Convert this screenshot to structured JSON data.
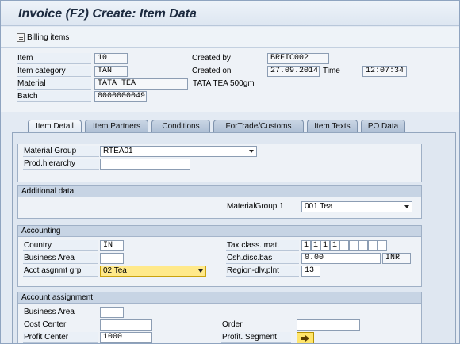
{
  "window": {
    "title": "Invoice  (F2) Create: Item Data"
  },
  "toolbar": {
    "billing_items_label": "Billing items",
    "billing_icon": "document-list-icon"
  },
  "header": {
    "item_label": "Item",
    "item_value": "10",
    "item_category_label": "Item category",
    "item_category_value": "TAN",
    "material_label": "Material",
    "material_value": "TATA TEA",
    "material_desc": "TATA TEA 500gm",
    "batch_label": "Batch",
    "batch_value": "0000000049",
    "created_by_label": "Created by",
    "created_by_value": "BRFIC002",
    "created_on_label": "Created on",
    "created_on_value": "27.09.2014",
    "time_label": "Time",
    "time_value": "12:07:34"
  },
  "tabs": [
    {
      "label": "Item Detail",
      "active": true
    },
    {
      "label": "Item Partners",
      "active": false
    },
    {
      "label": "Conditions",
      "active": false
    },
    {
      "label": "ForTrade/Customs",
      "active": false
    },
    {
      "label": "Item Texts",
      "active": false
    },
    {
      "label": "PO Data",
      "active": false
    }
  ],
  "item_detail": {
    "material_group_label": "Material Group",
    "material_group_value": "RTEA01",
    "prod_hierarchy_label": "Prod.hierarchy",
    "prod_hierarchy_value": ""
  },
  "additional": {
    "header": "Additional data",
    "material_group1_label": "MaterialGroup 1",
    "material_group1_value": "001 Tea"
  },
  "accounting": {
    "header": "Accounting",
    "country_label": "Country",
    "country_value": "IN",
    "business_area_label": "Business Area",
    "business_area_value": "",
    "acct_assgn_label": "Acct asgnmt grp",
    "acct_assgn_value": "02 Tea",
    "tax_class_label": "Tax class. mat.",
    "tax_class_values": [
      "1",
      "1",
      "1",
      "1",
      "",
      "",
      "",
      "",
      ""
    ],
    "csh_disc_label": "Csh.disc.bas",
    "csh_disc_value": "0.00",
    "currency": "INR",
    "region_label": "Region-dlv.plnt",
    "region_value": "13"
  },
  "account_assignment": {
    "header": "Account assignment",
    "business_area_label": "Business Area",
    "business_area_value": "",
    "cost_center_label": "Cost Center",
    "cost_center_value": "",
    "order_label": "Order",
    "order_value": "",
    "profit_center_label": "Profit Center",
    "profit_center_value": "1000",
    "profit_segment_label": "Profit. Segment",
    "profit_segment_icon": "arrow-right-icon"
  }
}
